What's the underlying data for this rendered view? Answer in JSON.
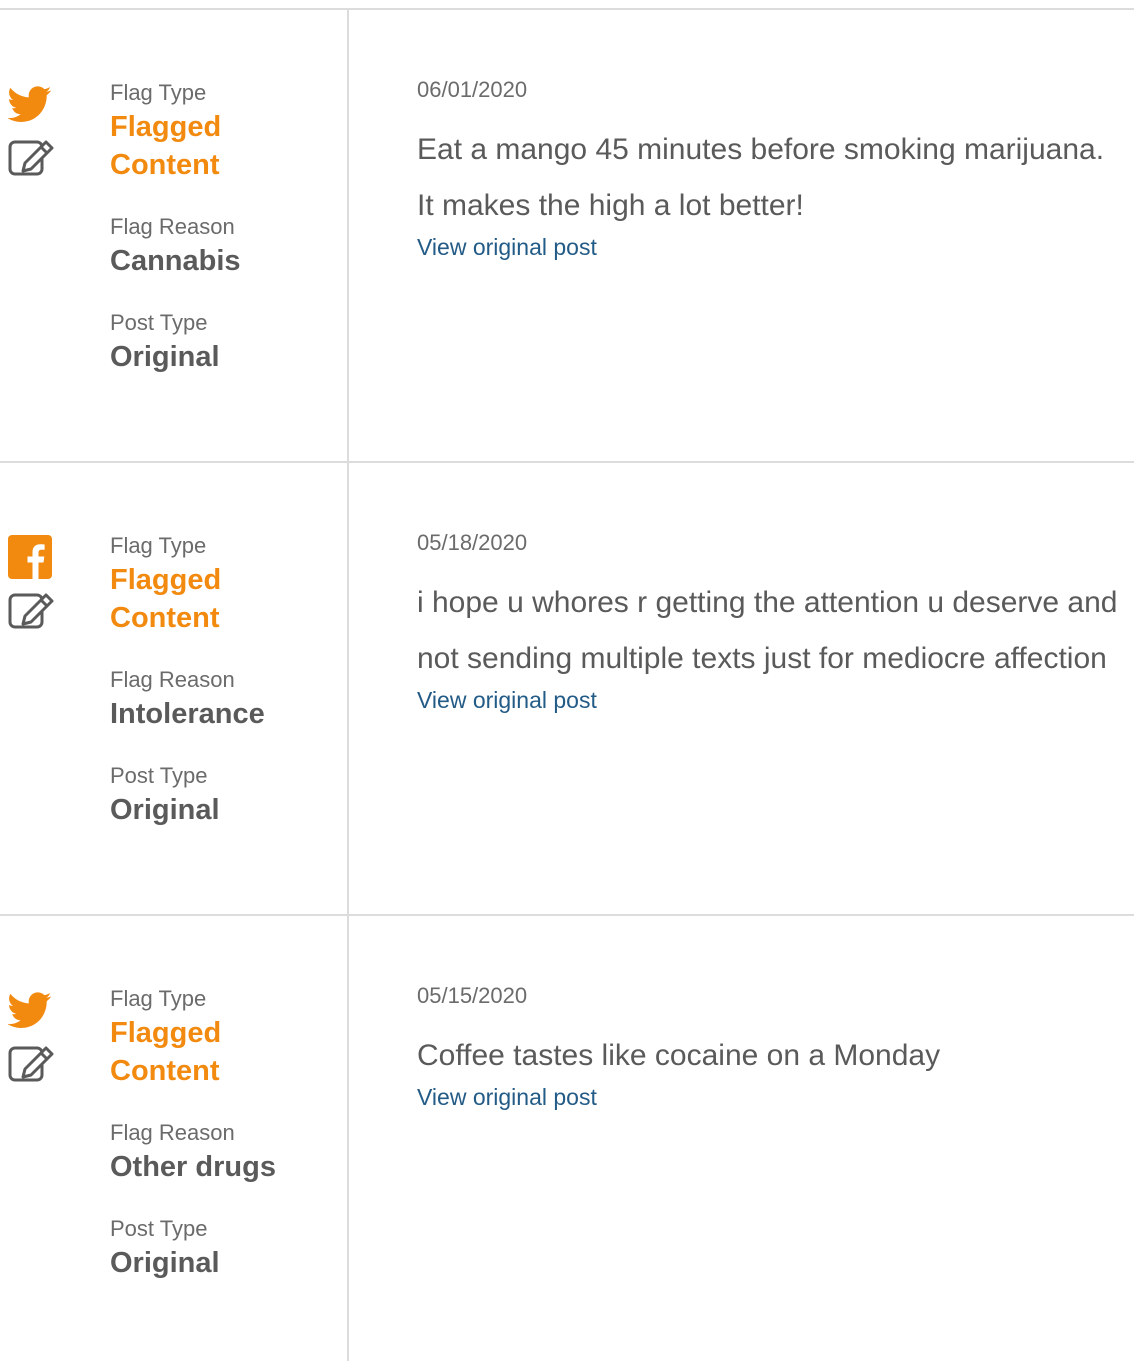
{
  "colors": {
    "accent": "#f28a10",
    "link": "#235b87",
    "text": "#5a5a5a",
    "muted": "#6b6b6b",
    "divider": "#dcdcdc"
  },
  "labels": {
    "flag_type": "Flag Type",
    "flag_reason": "Flag Reason",
    "post_type": "Post Type",
    "view_original": "View original post"
  },
  "posts": [
    {
      "network_icon": "twitter-icon",
      "flag_type": "Flagged Content",
      "flag_reason": "Cannabis",
      "post_type": "Original",
      "date": "06/01/2020",
      "text": "Eat a mango 45 minutes before smoking marijuana. It makes the high a lot better!"
    },
    {
      "network_icon": "facebook-icon",
      "flag_type": "Flagged Content",
      "flag_reason": "Intolerance",
      "post_type": "Original",
      "date": "05/18/2020",
      "text": "i hope u whores r getting the attention u deserve and not sending multiple texts just for mediocre affection"
    },
    {
      "network_icon": "twitter-icon",
      "flag_type": "Flagged Content",
      "flag_reason": "Other drugs",
      "post_type": "Original",
      "date": "05/15/2020",
      "text": "Coffee tastes like cocaine on a Monday"
    }
  ]
}
